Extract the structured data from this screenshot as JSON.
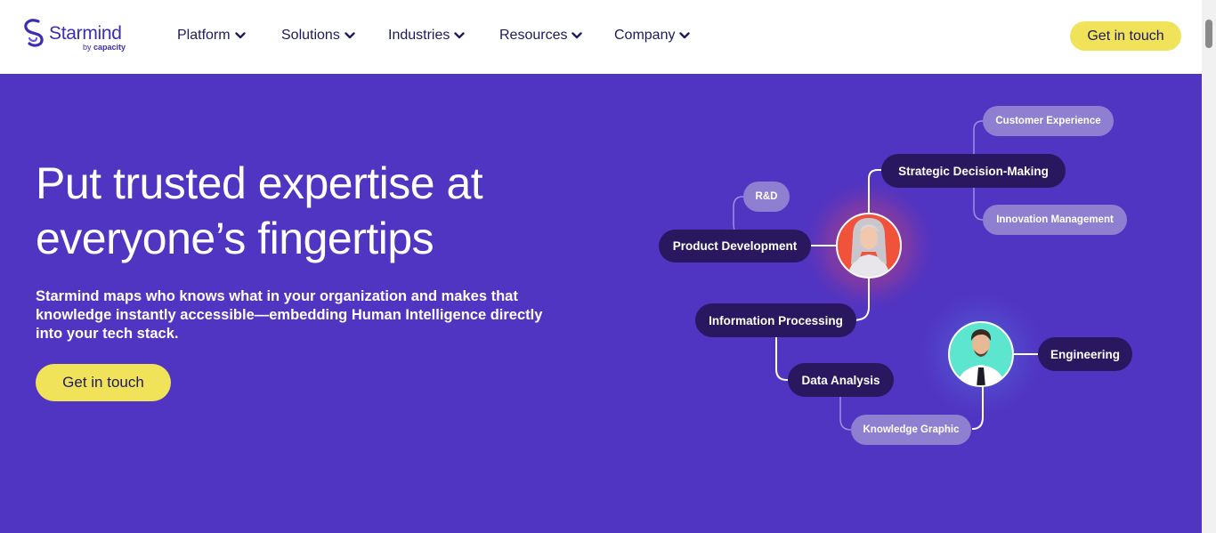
{
  "header": {
    "logo": {
      "name": "Starmind",
      "sub_prefix": "by",
      "sub_brand": "capacity"
    },
    "nav": [
      {
        "label": "Platform"
      },
      {
        "label": "Solutions"
      },
      {
        "label": "Industries"
      },
      {
        "label": "Resources"
      },
      {
        "label": "Company"
      }
    ],
    "cta_label": "Get in touch"
  },
  "hero": {
    "title_line1": "Put trusted expertise at",
    "title_line2": "everyone’s fingertips",
    "description": "Starmind maps who knows what in your organization and makes that knowledge instantly accessible—embedding Human Intelligence directly into your tech stack.",
    "cta_label": "Get in touch"
  },
  "diagram": {
    "nodes": {
      "customer_experience": "Customer Experience",
      "strategic_decision_making": "Strategic Decision-Making",
      "innovation_management": "Innovation Management",
      "rnd": "R&D",
      "product_development": "Product Development",
      "information_processing": "Information Processing",
      "data_analysis": "Data Analysis",
      "knowledge_graphic": "Knowledge Graphic",
      "engineering": "Engineering"
    }
  },
  "colors": {
    "hero_bg": "#5034c2",
    "accent_yellow": "#f0e35a",
    "brand_purple": "#3b2db6",
    "node_dark": "#29185f",
    "node_light": "#8e7fd0",
    "avatar_woman_bg": "#f0523c",
    "avatar_man_bg": "#5de6cf"
  }
}
